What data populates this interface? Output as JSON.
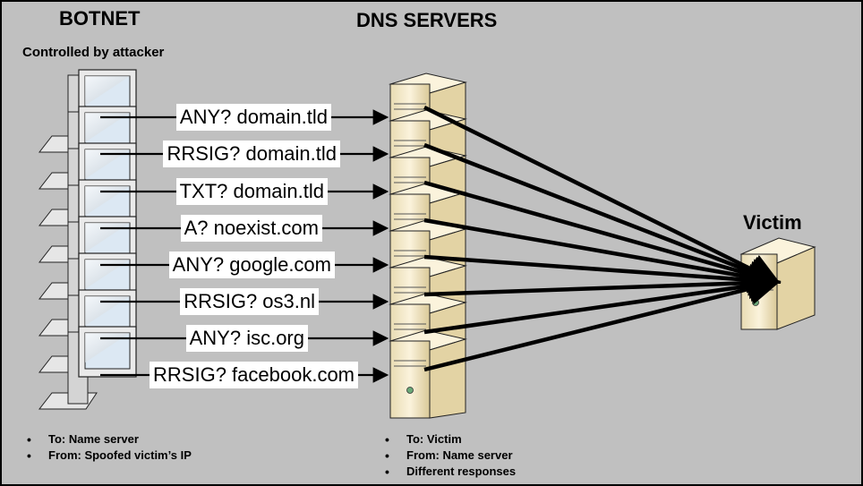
{
  "botnet": {
    "title": "BOTNET",
    "subtitle": "Controlled by attacker",
    "notes": [
      "To: Name server",
      "From: Spoofed victim’s IP"
    ]
  },
  "dns": {
    "title": "DNS SERVERS",
    "notes": [
      "To: Victim",
      "From: Name server",
      "Different responses"
    ]
  },
  "victim": {
    "title": "Victim"
  },
  "queries": [
    "ANY? domain.tld",
    "RRSIG? domain.tld",
    "TXT? domain.tld",
    "A? noexist.com",
    "ANY? google.com",
    "RRSIG? os3.nl",
    "ANY? isc.org",
    "RRSIG? facebook.com"
  ],
  "colors": {
    "background": "#c0c0c0",
    "server_body": "#f2e6c3",
    "monitor_screen": "#dce8f3",
    "arrow": "#000000"
  }
}
